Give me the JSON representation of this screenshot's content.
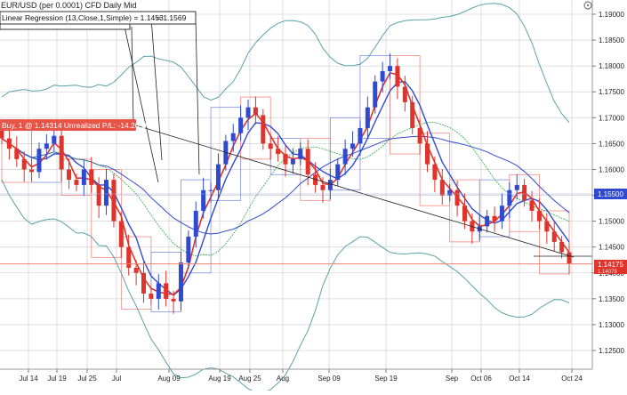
{
  "window": {
    "title": "EUR/USD (per 0.0001) CFD Daily Mid"
  },
  "indicator_box": {
    "label": "Linear Regression (13,Close,1,Simple) = 1.1453",
    "extra": "= 1.1569"
  },
  "position": {
    "label": "Buy, 1 @ 1.14314 Unrealized P/L: -14.20 USD"
  },
  "price_axis": {
    "ticks": [
      "1.19000",
      "1.18500",
      "1.18000",
      "1.17500",
      "1.17000",
      "1.16500",
      "1.16000",
      "1.15500",
      "1.15000",
      "1.14500",
      "1.14000",
      "1.13500",
      "1.13000",
      "1.12500"
    ],
    "badge_blue": "1.15500",
    "badge_red": "1.14175",
    "badge_red_under": "1.14079"
  },
  "date_axis": {
    "ticks": [
      "Jul 14",
      "Jul 19",
      "Jul 25",
      "Jul",
      "Aug 09",
      "Aug 19",
      "Aug 25",
      "Aug",
      "Sep 09",
      "Sep 19",
      "Sep",
      "Oct 06",
      "Oct 14",
      "Oct 24"
    ]
  },
  "colors": {
    "up": "#2f49d1",
    "down": "#e0332b",
    "grid": "#d5d5d5",
    "bollinger": "#5aa3a8",
    "ma_red": "#e0332b",
    "ma_blue": "#2f49d1",
    "ma_green": "#2fa84a",
    "price_line": "#f08070"
  },
  "chart_data": {
    "type": "candlestick",
    "instrument": "EUR/USD",
    "ylim": [
      1.12,
      1.19
    ],
    "current_price": 1.14175,
    "entry_price": 1.14314,
    "x": [
      "Jul 14",
      "Jul 19",
      "Jul 25",
      "Jul",
      "Aug 09",
      "Aug 19",
      "Aug 25",
      "Aug",
      "Sep 09",
      "Sep 19",
      "Sep",
      "Oct 06",
      "Oct 14",
      "Oct 24"
    ],
    "candles_close": [
      1.166,
      1.164,
      1.162,
      1.16,
      1.1595,
      1.164,
      1.165,
      1.1665,
      1.16,
      1.158,
      1.157,
      1.16,
      1.157,
      1.153,
      1.158,
      1.15,
      1.145,
      1.141,
      1.14,
      1.136,
      1.135,
      1.138,
      1.135,
      1.1345,
      1.142,
      1.147,
      1.152,
      1.156,
      1.156,
      1.161,
      1.1655,
      1.167,
      1.17,
      1.172,
      1.1705,
      1.165,
      1.164,
      1.163,
      1.161,
      1.162,
      1.164,
      1.159,
      1.157,
      1.156,
      1.158,
      1.161,
      1.164,
      1.165,
      1.168,
      1.172,
      1.177,
      1.179,
      1.18,
      1.176,
      1.173,
      1.168,
      1.165,
      1.161,
      1.158,
      1.155,
      1.156,
      1.153,
      1.15,
      1.148,
      1.149,
      1.151,
      1.15,
      1.153,
      1.156,
      1.157,
      1.154,
      1.152,
      1.15,
      1.148,
      1.146,
      1.144,
      1.1418
    ]
  }
}
